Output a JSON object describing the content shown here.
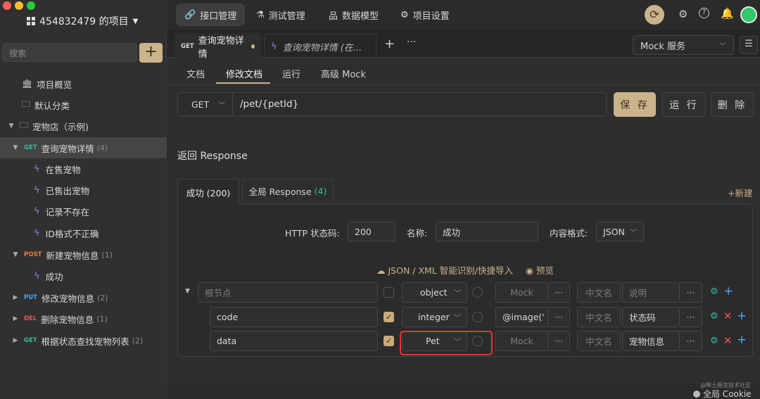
{
  "sidebar": {
    "project_title": "454832479 的项目",
    "search_placeholder": "搜索",
    "add_label": "+",
    "items": [
      {
        "label": "项目概览"
      },
      {
        "label": "默认分类"
      },
      {
        "label": "宠物店（示例)"
      },
      {
        "method": "GET",
        "label": "查询宠物详情",
        "count": "(4)"
      },
      {
        "label": "在售宠物"
      },
      {
        "label": "已售出宠物"
      },
      {
        "label": "记录不存在"
      },
      {
        "label": "ID格式不正确"
      },
      {
        "method": "POST",
        "label": "新建宠物信息",
        "count": "(1)"
      },
      {
        "label": "成功"
      },
      {
        "method": "PUT",
        "label": "修改宠物信息",
        "count": "(2)"
      },
      {
        "method": "DEL",
        "label": "删除宠物信息",
        "count": "(1)"
      },
      {
        "method": "GET",
        "label": "根据状态查找宠物列表",
        "count": "(2)"
      }
    ]
  },
  "topnav": {
    "tabs": [
      "接口管理",
      "测试管理",
      "数据模型",
      "项目设置"
    ]
  },
  "file_tabs": [
    {
      "method": "GET",
      "label": "查询宠物详情"
    },
    {
      "label": "查询宠物详情 (在..."
    }
  ],
  "mock_select": "Mock 服务",
  "sub_tabs": [
    "文档",
    "修改文档",
    "运行",
    "高级 Mock"
  ],
  "request": {
    "method": "GET",
    "path": "/pet/{petId}",
    "save": "保 存",
    "run": "运 行",
    "delete": "删 除"
  },
  "response": {
    "title": "返回 Response",
    "tab_success": "成功 (200)",
    "tab_global": "全局 Response",
    "tab_global_count": "(4)",
    "new_label": "+新建",
    "status_label": "HTTP 状态码:",
    "status_value": "200",
    "name_label": "名称:",
    "name_value": "成功",
    "format_label": "内容格式:",
    "format_value": "JSON",
    "import_label": "JSON / XML 智能识别/快捷导入",
    "preview_label": "预览"
  },
  "schema_rows": [
    {
      "name": "根节点",
      "type": "object",
      "mock": "Mock",
      "cn": "中文名",
      "desc": "说明"
    },
    {
      "name": "code",
      "type": "integer",
      "mock": "@image('",
      "cn": "中文名",
      "desc": "状态码"
    },
    {
      "name": "data",
      "type": "Pet",
      "mock": "Mock",
      "cn": "中文名",
      "desc": "宠物信息"
    }
  ],
  "footer": {
    "watermark": "@稀土掘金技术社区",
    "cookie": "全局 Cookie"
  },
  "colors": {
    "accent": "#cbb38b",
    "get": "#3bb5a0",
    "post": "#e5813a",
    "put": "#4da3f0",
    "del": "#e0555c",
    "highlight_box": "#e0362e"
  }
}
